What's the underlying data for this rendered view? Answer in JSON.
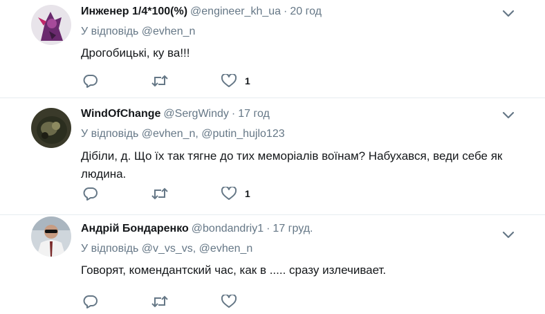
{
  "tweets": [
    {
      "fullname": "Инженер 1/4*100(%)",
      "handle": "@engineer_kh_ua",
      "separator": "·",
      "time": "20 год",
      "reply_prefix": "У відповідь",
      "reply_mentions": "@evhen_n",
      "text": "Дрогобицькі, ку  ва!!!",
      "like_count": "1"
    },
    {
      "fullname": "WindOfChange",
      "handle": "@SergWindy",
      "separator": "·",
      "time": "17 год",
      "reply_prefix": "У відповідь",
      "reply_mentions": "@evhen_n, @putin_hujlo123",
      "text": "Дібіли,    д. Що їх так тягне до тих меморіалів воїнам? Набухався, веди себе як людина.",
      "like_count": "1"
    },
    {
      "fullname": "Андрій Бондаренко",
      "handle": "@bondandriy1",
      "separator": "·",
      "time": "17 груд.",
      "reply_prefix": "У відповідь",
      "reply_mentions": "@v_vs_vs, @evhen_n",
      "text": "Говорят, комендантский час, как в ..... сразу излечивает.",
      "like_count": ""
    }
  ],
  "icons": {
    "reply": "reply-icon",
    "retweet": "retweet-icon",
    "like": "heart-icon",
    "more": "chevron-down-icon"
  },
  "colors": {
    "icon": "#657786",
    "text": "#14171a",
    "muted": "#657786",
    "border": "#e6ecf0"
  }
}
